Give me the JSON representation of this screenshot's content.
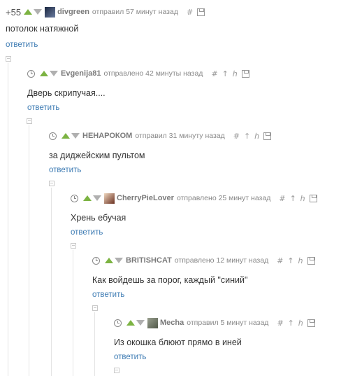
{
  "comments": [
    {
      "rating": "+55",
      "author": "divgreen",
      "meta": "отправил 57 минут назад",
      "text": "потолок натяжной",
      "reply": "ответить"
    },
    {
      "author": "Evgenija81",
      "meta": "отправлено 42 минуты назад",
      "text": "Дверь скрипучая....",
      "reply": "ответить"
    },
    {
      "author": "НЕНАРОКОМ",
      "meta": "отправил 31 минуту назад",
      "text": "за диджейским пультом",
      "reply": "ответить"
    },
    {
      "author": "CherryPieLover",
      "meta": "отправлено 25 минут назад",
      "text": "Хрень ебучая",
      "reply": "ответить"
    },
    {
      "author": "BRITISHCAT",
      "meta": "отправлено 12 минут назад",
      "text": "Как войдешь за порог, каждый \"синий\"",
      "reply": "ответить"
    },
    {
      "author": "Mecha",
      "meta": "отправил 5 минут назад",
      "text": "Из окошка блюют прямо в иней",
      "reply": "ответить"
    }
  ],
  "icons": {
    "hash": "#",
    "up_tree": "↑",
    "branch": "ℎ"
  },
  "colors": {
    "vote_up": "#7cb342",
    "vote_down": "#b0b0b0",
    "reply_link": "#3d7bb3",
    "author": "#7a7a7a",
    "meta": "#888888"
  }
}
